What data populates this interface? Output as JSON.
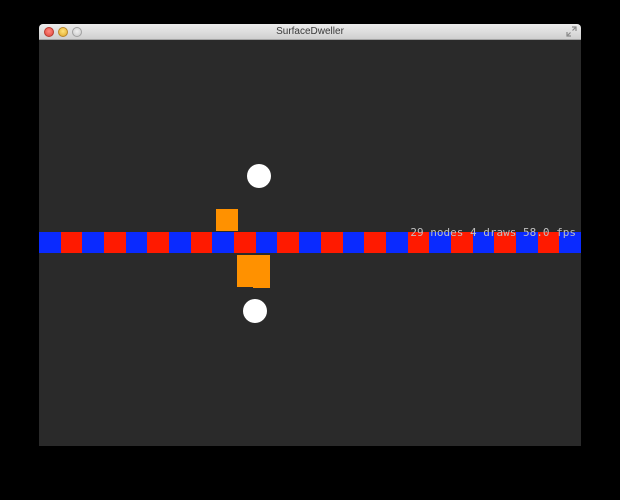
{
  "window": {
    "title": "SurfaceDweller"
  },
  "stats": {
    "text": "29 nodes 4 draws 58.0 fps"
  },
  "colors": {
    "background": "#2a2a2a",
    "strip_blue": "#0a2aff",
    "strip_red": "#ff1a00",
    "sprite_orange": "#ff9100",
    "ball": "#ffffff"
  },
  "strip_pattern": [
    "blue",
    "red",
    "blue",
    "red",
    "blue",
    "red",
    "blue",
    "red",
    "blue",
    "red",
    "blue",
    "red",
    "blue",
    "red",
    "blue",
    "red",
    "blue",
    "red",
    "blue",
    "red",
    "blue",
    "red",
    "blue",
    "red",
    "blue"
  ]
}
